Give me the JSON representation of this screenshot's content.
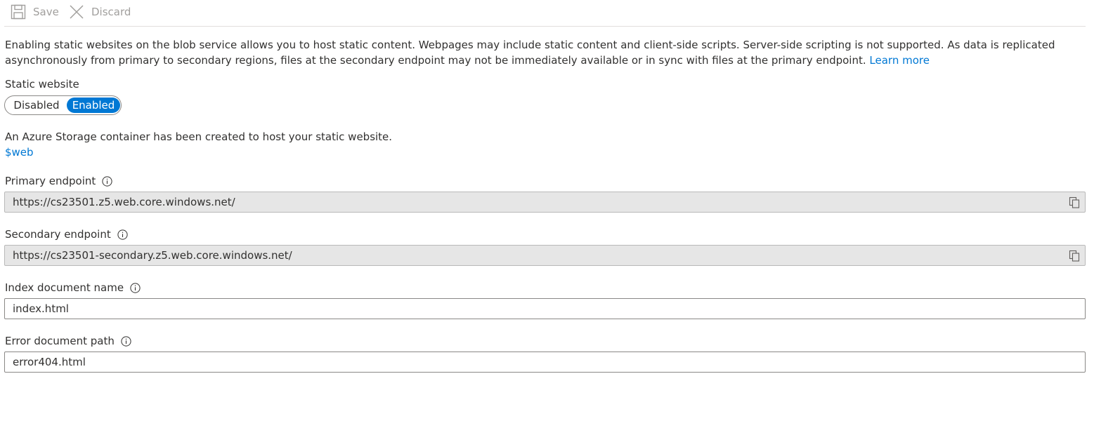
{
  "toolbar": {
    "save_label": "Save",
    "discard_label": "Discard",
    "save_icon": "save-icon",
    "discard_icon": "close-icon"
  },
  "description": {
    "text": "Enabling static websites on the blob service allows you to host static content. Webpages may include static content and client-side scripts. Server-side scripting is not supported. As data is replicated asynchronously from primary to secondary regions, files at the secondary endpoint may not be immediately available or in sync with files at the primary endpoint.",
    "learn_more": "Learn more"
  },
  "static_website": {
    "label": "Static website",
    "options": [
      "Disabled",
      "Enabled"
    ],
    "selected": "Enabled"
  },
  "container_info": {
    "text": "An Azure Storage container has been created to host your static website.",
    "link": "$web"
  },
  "primary_endpoint": {
    "label": "Primary endpoint",
    "value": "https://cs23501.z5.web.core.windows.net/"
  },
  "secondary_endpoint": {
    "label": "Secondary endpoint",
    "value": "https://cs23501-secondary.z5.web.core.windows.net/"
  },
  "index_document": {
    "label": "Index document name",
    "value": "index.html"
  },
  "error_document": {
    "label": "Error document path",
    "value": "error404.html"
  },
  "colors": {
    "accent": "#0078d4",
    "disabled_text": "#a19f9d",
    "readonly_bg": "#e6e6e6"
  }
}
